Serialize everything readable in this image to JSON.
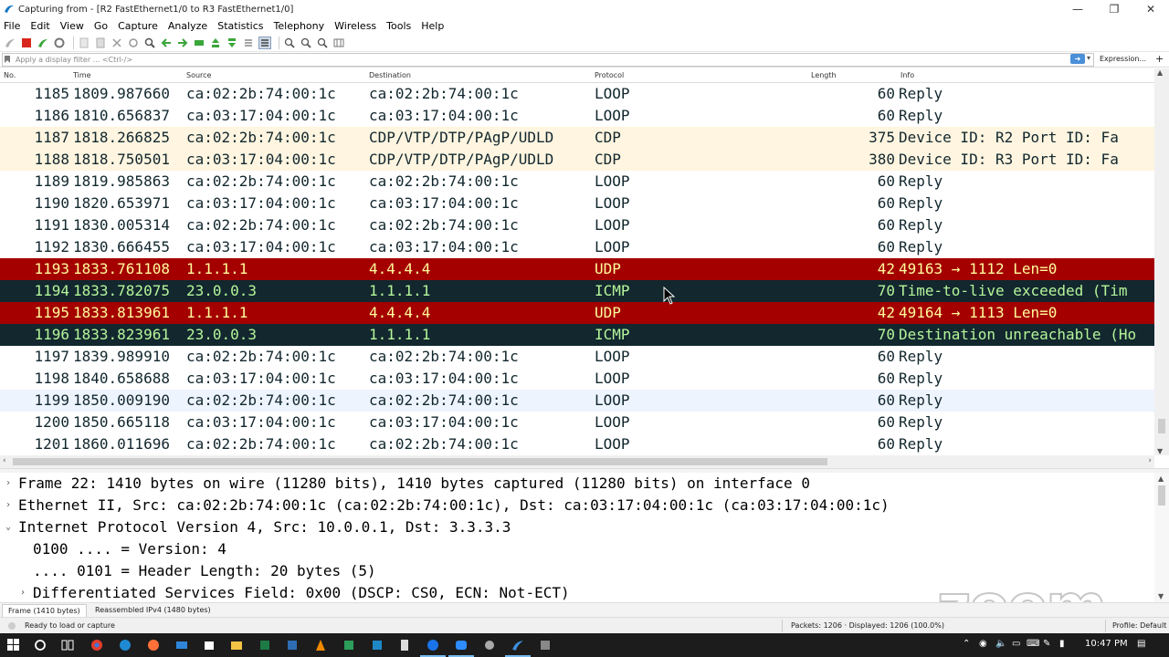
{
  "window": {
    "title": "Capturing from - [R2 FastEthernet1/0 to R3 FastEthernet1/0]",
    "minimize": "—",
    "maximize": "❐",
    "close": "✕"
  },
  "menu": [
    "File",
    "Edit",
    "View",
    "Go",
    "Capture",
    "Analyze",
    "Statistics",
    "Telephony",
    "Wireless",
    "Tools",
    "Help"
  ],
  "filter": {
    "placeholder": "Apply a display filter ... <Ctrl-/>",
    "expression_label": "Expression...",
    "plus_label": "+"
  },
  "packet_list": {
    "columns": [
      "No.",
      "Time",
      "Source",
      "Destination",
      "Protocol",
      "Length",
      "Info"
    ],
    "rows": [
      {
        "no": "1185",
        "time": "1809.987660",
        "src": "ca:02:2b:74:00:1c",
        "dst": "ca:02:2b:74:00:1c",
        "proto": "LOOP",
        "len": "60",
        "info": "Reply",
        "style": "white"
      },
      {
        "no": "1186",
        "time": "1810.656837",
        "src": "ca:03:17:04:00:1c",
        "dst": "ca:03:17:04:00:1c",
        "proto": "LOOP",
        "len": "60",
        "info": "Reply",
        "style": "white"
      },
      {
        "no": "1187",
        "time": "1818.266825",
        "src": "ca:02:2b:74:00:1c",
        "dst": "CDP/VTP/DTP/PAgP/UDLD",
        "proto": "CDP",
        "len": "375",
        "info": "Device ID: R2  Port ID: Fa",
        "style": "cdp"
      },
      {
        "no": "1188",
        "time": "1818.750501",
        "src": "ca:03:17:04:00:1c",
        "dst": "CDP/VTP/DTP/PAgP/UDLD",
        "proto": "CDP",
        "len": "380",
        "info": "Device ID: R3  Port ID: Fa",
        "style": "cdp"
      },
      {
        "no": "1189",
        "time": "1819.985863",
        "src": "ca:02:2b:74:00:1c",
        "dst": "ca:02:2b:74:00:1c",
        "proto": "LOOP",
        "len": "60",
        "info": "Reply",
        "style": "white"
      },
      {
        "no": "1190",
        "time": "1820.653971",
        "src": "ca:03:17:04:00:1c",
        "dst": "ca:03:17:04:00:1c",
        "proto": "LOOP",
        "len": "60",
        "info": "Reply",
        "style": "white"
      },
      {
        "no": "1191",
        "time": "1830.005314",
        "src": "ca:02:2b:74:00:1c",
        "dst": "ca:02:2b:74:00:1c",
        "proto": "LOOP",
        "len": "60",
        "info": "Reply",
        "style": "white"
      },
      {
        "no": "1192",
        "time": "1830.666455",
        "src": "ca:03:17:04:00:1c",
        "dst": "ca:03:17:04:00:1c",
        "proto": "LOOP",
        "len": "60",
        "info": "Reply",
        "style": "white"
      },
      {
        "no": "1193",
        "time": "1833.761108",
        "src": "1.1.1.1",
        "dst": "4.4.4.4",
        "proto": "UDP",
        "len": "42",
        "info": "49163 → 1112 Len=0",
        "style": "udp"
      },
      {
        "no": "1194",
        "time": "1833.782075",
        "src": "23.0.0.3",
        "dst": "1.1.1.1",
        "proto": "ICMP",
        "len": "70",
        "info": "Time-to-live exceeded (Tim",
        "style": "icmp"
      },
      {
        "no": "1195",
        "time": "1833.813961",
        "src": "1.1.1.1",
        "dst": "4.4.4.4",
        "proto": "UDP",
        "len": "42",
        "info": "49164 → 1113 Len=0",
        "style": "udp"
      },
      {
        "no": "1196",
        "time": "1833.823961",
        "src": "23.0.0.3",
        "dst": "1.1.1.1",
        "proto": "ICMP",
        "len": "70",
        "info": "Destination unreachable (Ho",
        "style": "icmp"
      },
      {
        "no": "1197",
        "time": "1839.989910",
        "src": "ca:02:2b:74:00:1c",
        "dst": "ca:02:2b:74:00:1c",
        "proto": "LOOP",
        "len": "60",
        "info": "Reply",
        "style": "white"
      },
      {
        "no": "1198",
        "time": "1840.658688",
        "src": "ca:03:17:04:00:1c",
        "dst": "ca:03:17:04:00:1c",
        "proto": "LOOP",
        "len": "60",
        "info": "Reply",
        "style": "white"
      },
      {
        "no": "1199",
        "time": "1850.009190",
        "src": "ca:02:2b:74:00:1c",
        "dst": "ca:02:2b:74:00:1c",
        "proto": "LOOP",
        "len": "60",
        "info": "Reply",
        "style": "hover"
      },
      {
        "no": "1200",
        "time": "1850.665118",
        "src": "ca:03:17:04:00:1c",
        "dst": "ca:03:17:04:00:1c",
        "proto": "LOOP",
        "len": "60",
        "info": "Reply",
        "style": "white"
      },
      {
        "no": "1201",
        "time": "1860.011696",
        "src": "ca:02:2b:74:00:1c",
        "dst": "ca:02:2b:74:00:1c",
        "proto": "LOOP",
        "len": "60",
        "info": "Reply",
        "style": "white"
      }
    ]
  },
  "details": [
    {
      "arrow": "›",
      "indent": 0,
      "text": "Frame 22: 1410 bytes on wire (11280 bits), 1410 bytes captured (11280 bits) on interface 0"
    },
    {
      "arrow": "›",
      "indent": 0,
      "text": "Ethernet II, Src: ca:02:2b:74:00:1c (ca:02:2b:74:00:1c), Dst: ca:03:17:04:00:1c (ca:03:17:04:00:1c)"
    },
    {
      "arrow": "⌄",
      "indent": 0,
      "text": "Internet Protocol Version 4, Src: 10.0.0.1, Dst: 3.3.3.3"
    },
    {
      "arrow": "",
      "indent": 1,
      "text": "0100 .... = Version: 4"
    },
    {
      "arrow": "",
      "indent": 1,
      "text": ".... 0101 = Header Length: 20 bytes (5)"
    },
    {
      "arrow": "›",
      "indent": 1,
      "text": "Differentiated Services Field: 0x00 (DSCP: CS0, ECN: Not-ECT)"
    }
  ],
  "byte_tabs": [
    "Frame (1410 bytes)",
    "Reassembled IPv4 (1480 bytes)"
  ],
  "status": {
    "ready": "Ready to load or capture",
    "packets": "Packets: 1206 · Displayed: 1206 (100.0%)",
    "profile": "Profile: Default"
  },
  "watermark": "zoom",
  "taskbar": {
    "clock": "10:47 PM"
  },
  "colors": {
    "udp_bg": "#a40000",
    "udp_fg": "#fffc9c",
    "icmp_bg": "#12272e",
    "icmp_fg": "#b5f59a",
    "cdp_bg": "#fff5e0"
  }
}
